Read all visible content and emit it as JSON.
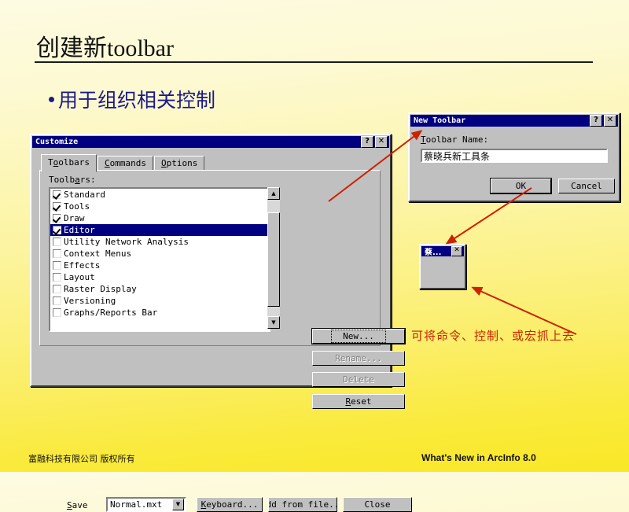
{
  "slide": {
    "title": "创建新toolbar",
    "bullet": "用于组织相关控制",
    "note": "可将命令、控制、或宏抓上去",
    "footer_left": "富融科技有限公司 版权所有",
    "footer_right": "What's New in ArcInfo 8.0"
  },
  "customize": {
    "title": "Customize",
    "help_btn": "?",
    "close_btn": "✕",
    "tabs": [
      {
        "label": "Toolbars",
        "active": true
      },
      {
        "label": "Commands",
        "active": false
      },
      {
        "label": "Options",
        "active": false
      }
    ],
    "list_label": "Toolbars:",
    "items": [
      {
        "label": "Standard",
        "checked": true,
        "selected": false
      },
      {
        "label": "Tools",
        "checked": true,
        "selected": false
      },
      {
        "label": "Draw",
        "checked": true,
        "selected": false
      },
      {
        "label": "Editor",
        "checked": true,
        "selected": true
      },
      {
        "label": "Utility Network Analysis",
        "checked": false,
        "selected": false
      },
      {
        "label": "Context Menus",
        "checked": false,
        "selected": false
      },
      {
        "label": "Effects",
        "checked": false,
        "selected": false
      },
      {
        "label": "Layout",
        "checked": false,
        "selected": false
      },
      {
        "label": "Raster Display",
        "checked": false,
        "selected": false
      },
      {
        "label": "Versioning",
        "checked": false,
        "selected": false
      },
      {
        "label": "Graphs/Reports Bar",
        "checked": false,
        "selected": false
      }
    ],
    "buttons": {
      "new": "New...",
      "rename": "Rename...",
      "delete": "Delete",
      "reset": "Reset"
    },
    "bottom": {
      "save_label": "Save",
      "save_target": "Normal.mxt",
      "keyboard": "Keyboard...",
      "add_from_file": "dd from file..",
      "close": "Close"
    }
  },
  "new_toolbar": {
    "title": "New Toolbar",
    "help_btn": "?",
    "close_btn": "✕",
    "name_label": "Toolbar Name:",
    "name_value": "蔡晓兵新工具条",
    "ok": "OK",
    "cancel": "Cancel"
  },
  "mini_toolbar": {
    "title": "蔡...",
    "close_btn": "✕"
  },
  "colors": {
    "accent_red": "#cc2200",
    "title_blue": "#000080",
    "bullet_blue": "#1a1a8c",
    "face": "#c0c0c0"
  }
}
